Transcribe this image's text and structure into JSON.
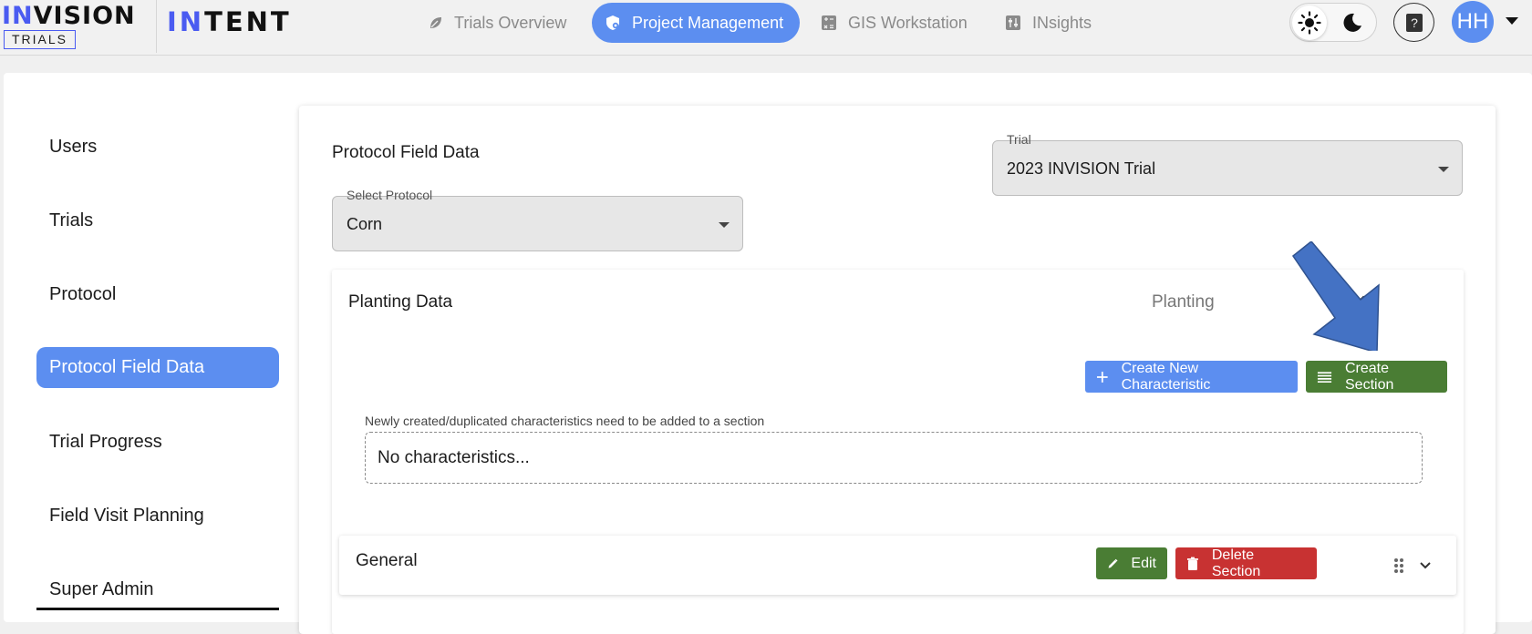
{
  "brand": {
    "logo_primary_accent": "IN",
    "logo_primary_rest": "VISION",
    "logo_primary_sub": "TRIALS",
    "logo_secondary_accent": "IN",
    "logo_secondary_rest": "TENT",
    "accent_color": "#4a5bf1"
  },
  "nav": {
    "tabs": [
      {
        "label": "Trials Overview",
        "icon": "leaf-icon",
        "active": false
      },
      {
        "label": "Project Management",
        "icon": "shield-gear-icon",
        "active": true
      },
      {
        "label": "GIS Workstation",
        "icon": "calculator-icon",
        "active": false
      },
      {
        "label": "INsights",
        "icon": "sliders-icon",
        "active": false
      }
    ],
    "active_color": "#5c8ef0"
  },
  "header": {
    "help_label": "?",
    "avatar_initials": "HH"
  },
  "sidebar": {
    "items": [
      {
        "label": "Users",
        "active": false
      },
      {
        "label": "Trials",
        "active": false
      },
      {
        "label": "Protocol",
        "active": false
      },
      {
        "label": "Protocol Field Data",
        "active": true
      },
      {
        "label": "Trial Progress",
        "active": false
      },
      {
        "label": "Field Visit Planning",
        "active": false
      },
      {
        "label": "Super Admin",
        "active": false
      }
    ]
  },
  "main": {
    "title": "Protocol Field Data",
    "trial_select": {
      "label": "Trial",
      "value": "2023 INVISION Trial"
    },
    "protocol_select": {
      "label": "Select Protocol",
      "value": "Corn"
    },
    "accordion": {
      "title": "Planting Data",
      "category": "Planting",
      "create_characteristic_label": "Create New Characteristic",
      "create_section_label": "Create Section",
      "hint": "Newly created/duplicated characteristics need to be added to a section",
      "empty_text": "No characteristics...",
      "section": {
        "title": "General",
        "edit_label": "Edit",
        "delete_label": "Delete Section"
      }
    }
  },
  "colors": {
    "green_button": "#4a7d34",
    "red_button": "#c83232",
    "blue_button": "#5c8ef0",
    "annotation_arrow": "#4472c4"
  }
}
